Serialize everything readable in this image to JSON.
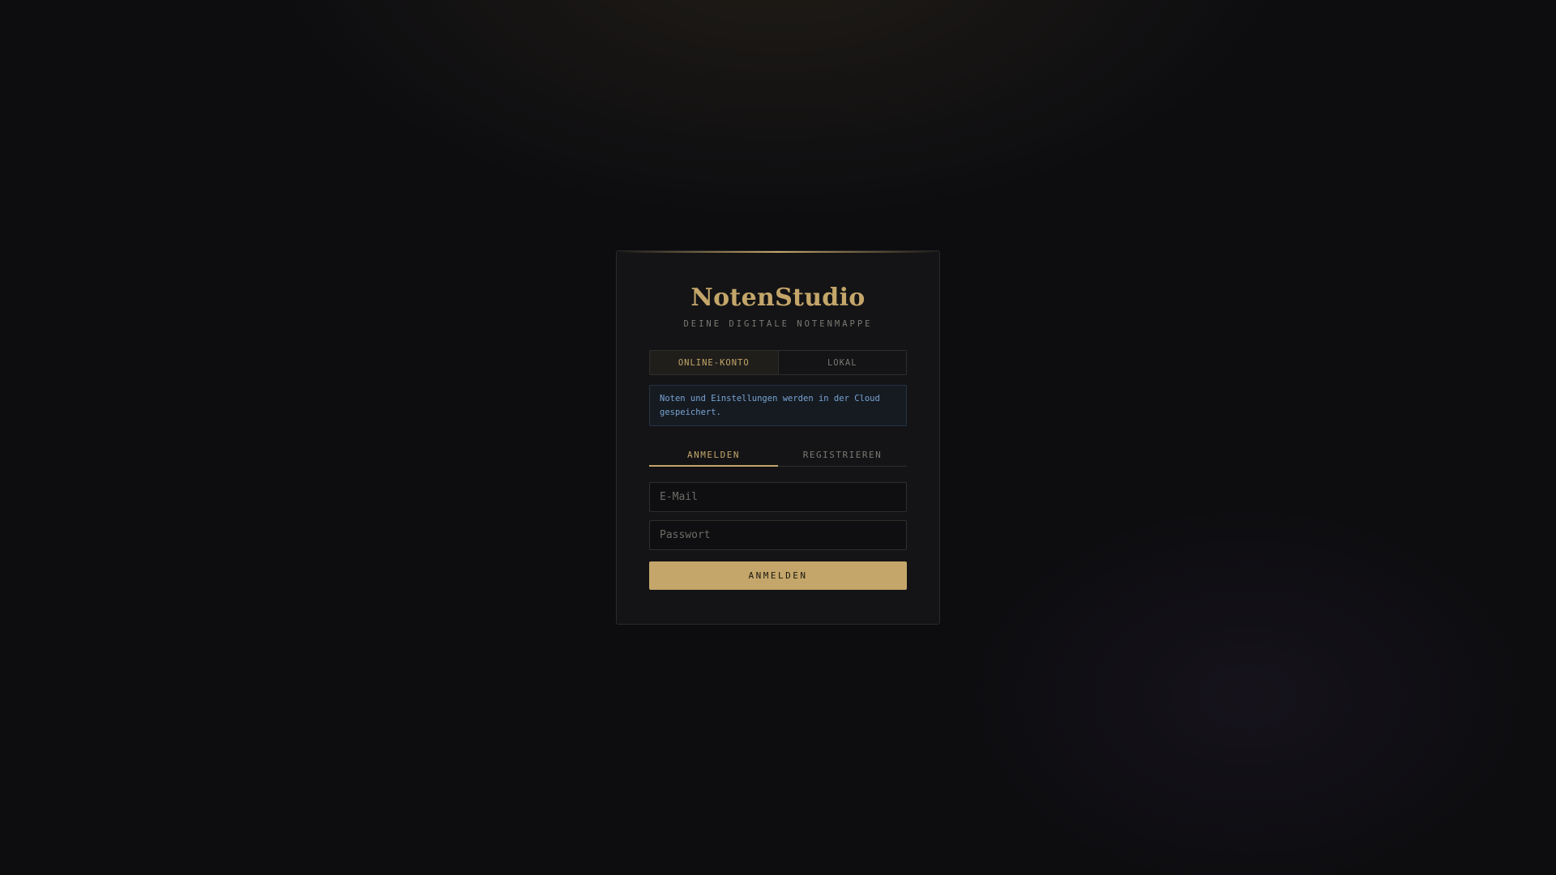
{
  "app": {
    "title": "NotenStudio",
    "subtitle": "DEINE DIGITALE NOTENMAPPE"
  },
  "mode_toggle": {
    "options": [
      {
        "label": "ONLINE-KONTO",
        "active": true
      },
      {
        "label": "LOKAL",
        "active": false
      }
    ]
  },
  "info": {
    "text": "Noten und Einstellungen werden in der Cloud gespeichert."
  },
  "auth_tabs": [
    {
      "label": "ANMELDEN",
      "active": true
    },
    {
      "label": "REGISTRIEREN",
      "active": false
    }
  ],
  "form": {
    "email": {
      "value": "",
      "placeholder": "E-Mail"
    },
    "password": {
      "value": "",
      "placeholder": "Passwort"
    },
    "submit_label": "ANMELDEN"
  },
  "colors": {
    "accent": "#c4a66a",
    "background": "#0d0d10",
    "card": "#141416",
    "info_text": "#78a4d2",
    "info_bg": "#161b22"
  }
}
